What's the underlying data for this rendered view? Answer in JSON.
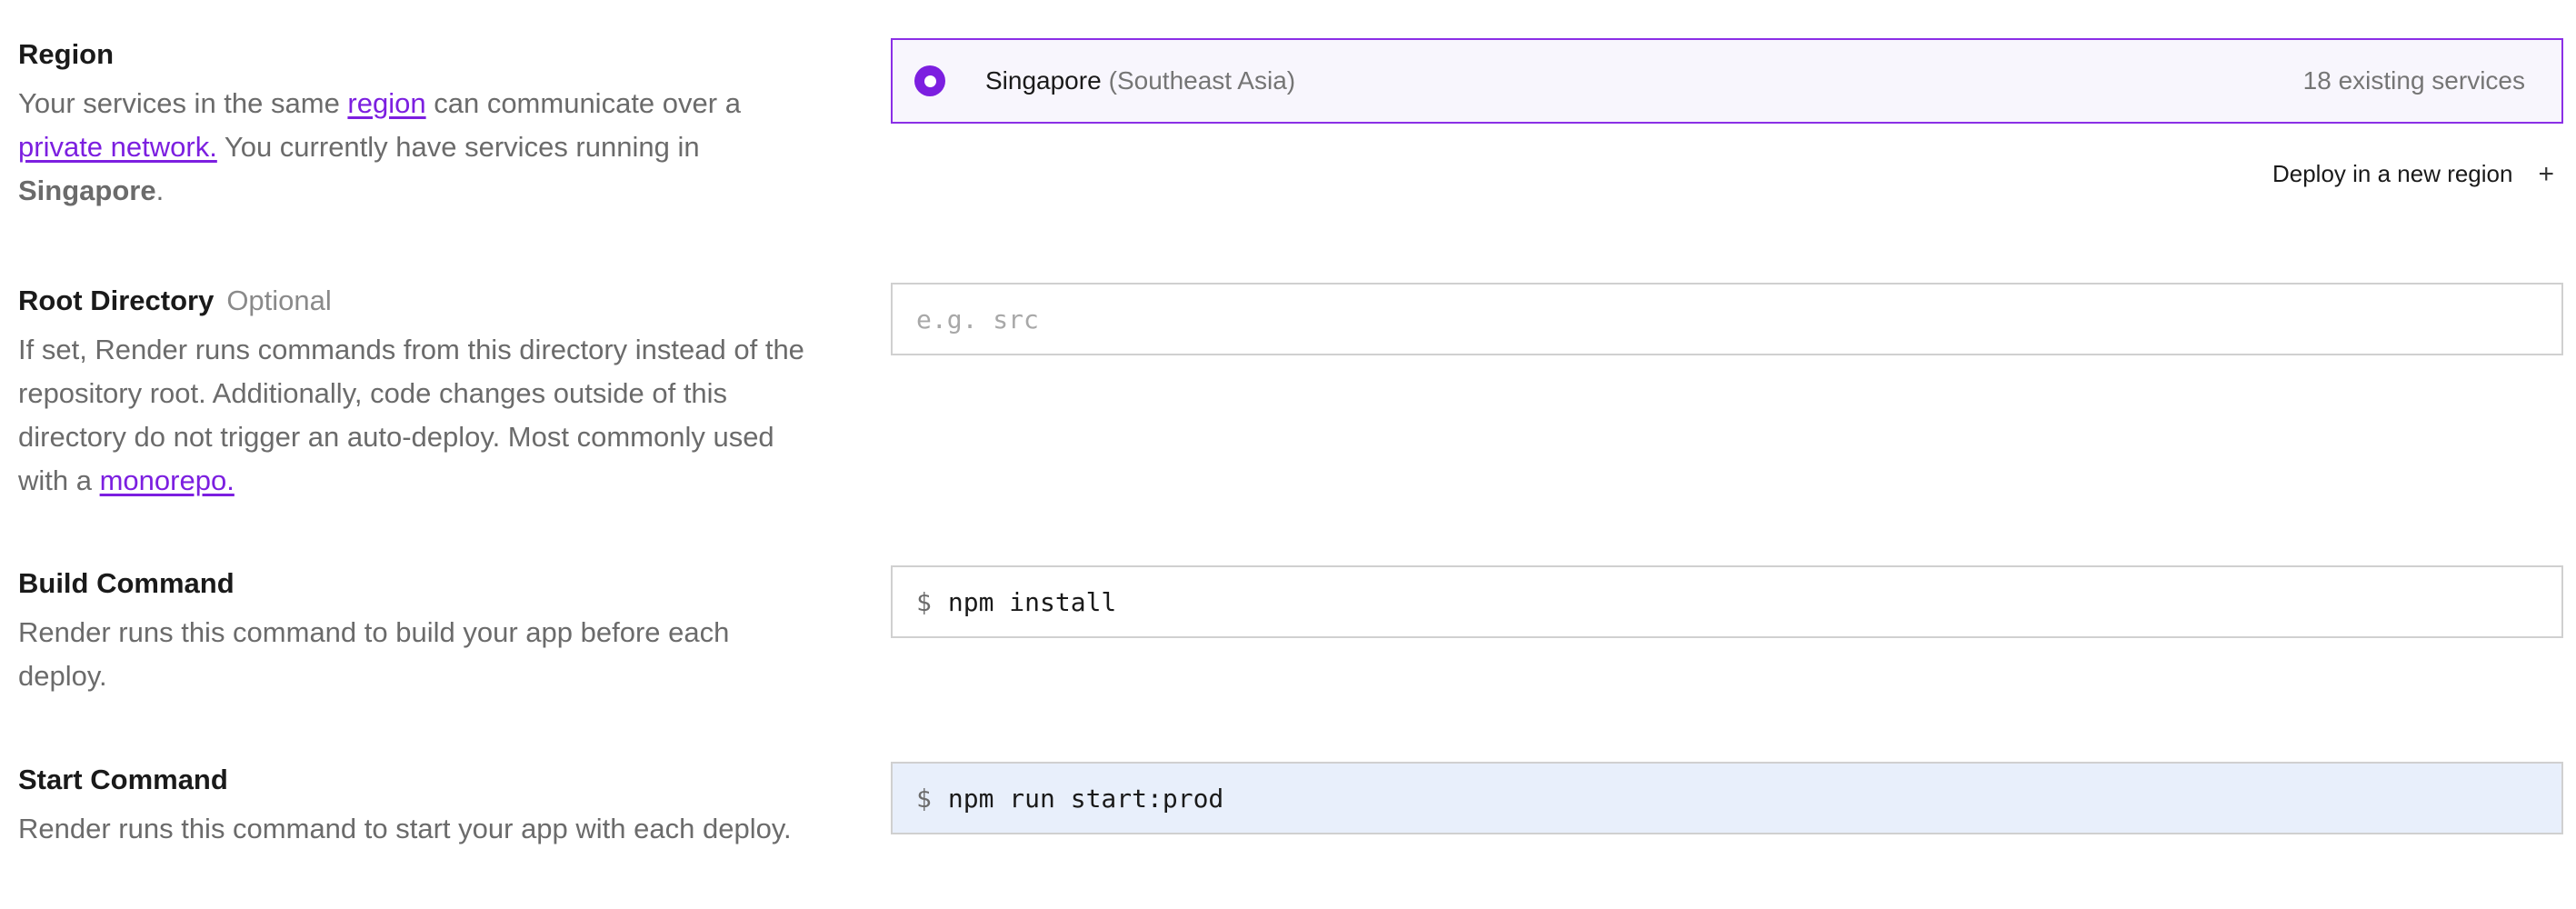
{
  "region": {
    "heading": "Region",
    "desc_part1": "Your services in the same ",
    "desc_link1": "region",
    "desc_part2": " can communicate over a ",
    "desc_link2": "private network.",
    "desc_part3": " You currently have services running in ",
    "desc_bold": "Singapore",
    "desc_part4": ".",
    "selected": {
      "name": "Singapore",
      "sub": "(Southeast Asia)",
      "count": "18 existing services"
    },
    "deploy_new_label": "Deploy in a new region",
    "deploy_new_icon": "+"
  },
  "root_directory": {
    "heading": "Root Directory",
    "optional": "Optional",
    "desc_part1": "If set, Render runs commands from this directory instead of the repository root. Additionally, code changes outside of this directory do not trigger an auto-deploy. Most commonly used with a ",
    "desc_link": "monorepo.",
    "placeholder": "e.g. src",
    "value": ""
  },
  "build_command": {
    "heading": "Build Command",
    "desc": "Render runs this command to build your app before each deploy.",
    "prefix": "$",
    "value": "npm install"
  },
  "start_command": {
    "heading": "Start Command",
    "desc": "Render runs this command to start your app with each deploy.",
    "prefix": "$",
    "value": "npm run start:prod"
  },
  "colors": {
    "accent": "#7c1fe0",
    "selected_bg": "#f8f6fd",
    "filled_input_bg": "#e8effb"
  }
}
